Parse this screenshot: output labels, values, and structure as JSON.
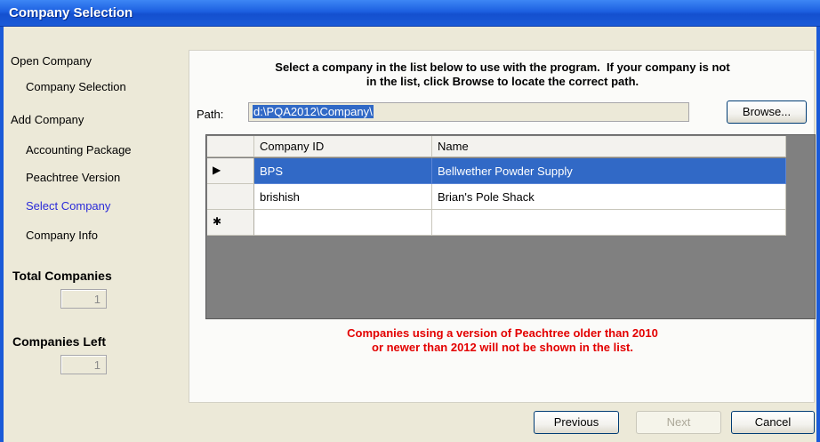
{
  "window": {
    "title": "Company Selection"
  },
  "sidebar": {
    "items": [
      {
        "label": "Open Company",
        "level": 0,
        "active": false
      },
      {
        "label": "Company Selection",
        "level": 1,
        "active": false
      },
      {
        "label": "Add Company",
        "level": 0,
        "active": false
      },
      {
        "label": "Accounting Package",
        "level": 1,
        "active": false
      },
      {
        "label": "Peachtree Version",
        "level": 1,
        "active": false
      },
      {
        "label": "Select Company",
        "level": 1,
        "active": true
      },
      {
        "label": "Company Info",
        "level": 1,
        "active": false
      }
    ],
    "total_companies": {
      "label": "Total Companies",
      "value": "1"
    },
    "companies_left": {
      "label": "Companies Left",
      "value": "1"
    }
  },
  "main": {
    "instructions_line1": "Select a company in the list below to use with the program.  If your company is not",
    "instructions_line2": "in the list, click Browse to locate the correct path.",
    "path_label": "Path:",
    "path_value": "d:\\PQA2012\\Company\\",
    "browse_label": "Browse...",
    "grid": {
      "columns": [
        "Company ID",
        "Name"
      ],
      "rows": [
        {
          "marker": "▶",
          "id": "BPS",
          "name": "Bellwether Powder Supply",
          "selected": true
        },
        {
          "marker": "",
          "id": "brishish",
          "name": "Brian's Pole Shack",
          "selected": false
        },
        {
          "marker": "✱",
          "id": "",
          "name": "",
          "selected": false
        }
      ]
    },
    "warning_line1": "Companies using a version of Peachtree older than 2010",
    "warning_line2": "or newer than 2012 will not be shown in the list."
  },
  "footer": {
    "previous_label": "Previous",
    "next_label": "Next",
    "cancel_label": "Cancel"
  },
  "colors": {
    "title_bar": "#1a5ad8",
    "selection": "#3169c6",
    "active_nav": "#2b2bd9",
    "warning": "#e30000"
  }
}
